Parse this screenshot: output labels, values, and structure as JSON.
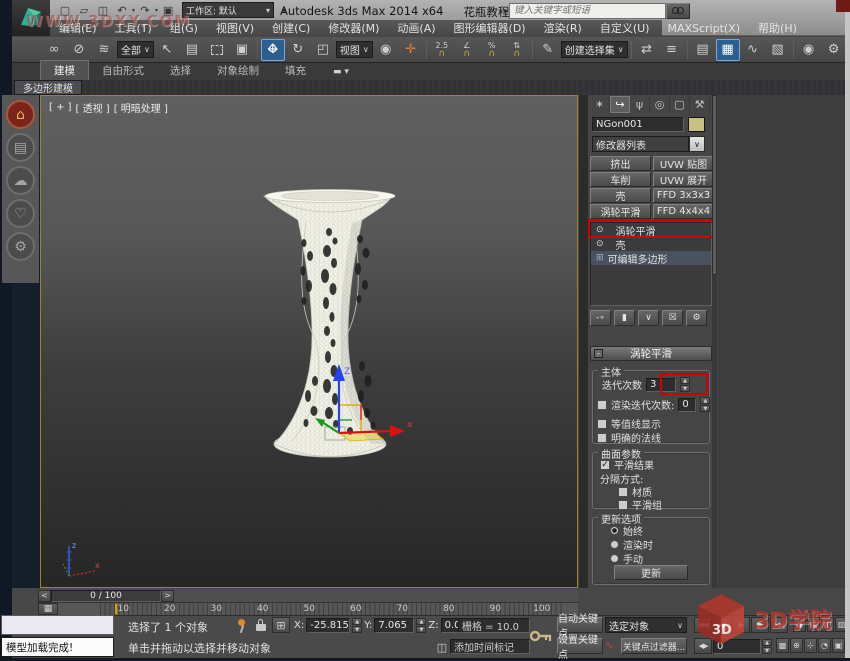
{
  "window": {
    "title_app": "Autodesk 3ds Max  2014 x64",
    "title_doc": "花瓶教程.max",
    "workspace": "工作区: 默认",
    "search_placeholder": "键入关键字或短语"
  },
  "menus": {
    "items": [
      "编辑(E)",
      "工具(T)",
      "组(G)",
      "视图(V)",
      "创建(C)",
      "修改器(M)",
      "动画(A)",
      "图形编辑器(D)",
      "渲染(R)",
      "自定义(U)",
      "MAXScript(X)",
      "帮助(H)"
    ]
  },
  "toolbar": {
    "selection_filter": "全部",
    "coord_system": "视图",
    "named_sets": "创建选择集",
    "snap_value": "2.5"
  },
  "ribbon": {
    "tabs": [
      "建模",
      "自由形式",
      "选择",
      "对象绘制",
      "填充"
    ],
    "subtab": "多边形建模"
  },
  "viewport": {
    "label_general": "[ + ]",
    "label_pov": "[ 透视 ]",
    "label_shading": "[ 明暗处理 ]",
    "gizmo_z_label": "Z",
    "gizmo_x_label": "x",
    "axis_z_label": "z",
    "axis_x_label": "x"
  },
  "command_panel": {
    "object_name": "NGon001",
    "object_color": "#c9c27f",
    "modifier_list_label": "修改器列表",
    "modifier_buttons": [
      "挤出",
      "UVW 贴图",
      "车削",
      "UVW 展开",
      "壳",
      "FFD 3x3x3",
      "涡轮平滑",
      "FFD 4x4x4"
    ],
    "stack_items": [
      "涡轮平滑",
      "壳",
      "可编辑多边形"
    ],
    "turbosmooth": {
      "rollout_title": "涡轮平滑",
      "group_main": "主体",
      "iterations_label": "迭代次数",
      "iterations_value": "3",
      "render_iterations_label": "渲染迭代次数:",
      "render_iterations_value": "0",
      "isoline_label": "等值线显示",
      "explicit_normals_label": "明确的法线",
      "group_surface": "曲面参数",
      "smooth_result_label": "平滑结果",
      "separate_by_label": "分隔方式:",
      "materials_label": "材质",
      "smoothing_groups_label": "平滑组",
      "group_update": "更新选项",
      "update_always": "始终",
      "update_render": "渲染时",
      "update_manual": "手动",
      "update_button": "更新"
    }
  },
  "timeline": {
    "counter": "0 / 100",
    "prev": "<",
    "next": ">",
    "ticks": [
      "10",
      "20",
      "30",
      "40",
      "50",
      "60",
      "70",
      "80",
      "90",
      "100"
    ]
  },
  "status_bar": {
    "toast": "模型加载完成!",
    "selection_status": "选择了 1 个对象",
    "prompt": "单击并拖动以选择并移动对象",
    "x_label": "X:",
    "x_value": "-25.815",
    "y_label": "Y:",
    "y_value": "7.065",
    "z_label": "Z:",
    "z_value": "0.0",
    "grid_label": "栅格 = 10.0",
    "time_tag_label": "添加时间标记",
    "auto_key": "自动关键点",
    "set_key": "设置关键点",
    "key_mode": "选定对象",
    "key_filters": "关键点过滤器...",
    "frame_value": "0"
  },
  "watermarks": {
    "site": "WWW.3DXY.COM",
    "brand": "3D学院",
    "brand_mark": "3D"
  },
  "colors": {
    "annotation_red": "#d40000",
    "viewport_border": "#9c8428",
    "highlight_blue": "#2c5e8f"
  }
}
